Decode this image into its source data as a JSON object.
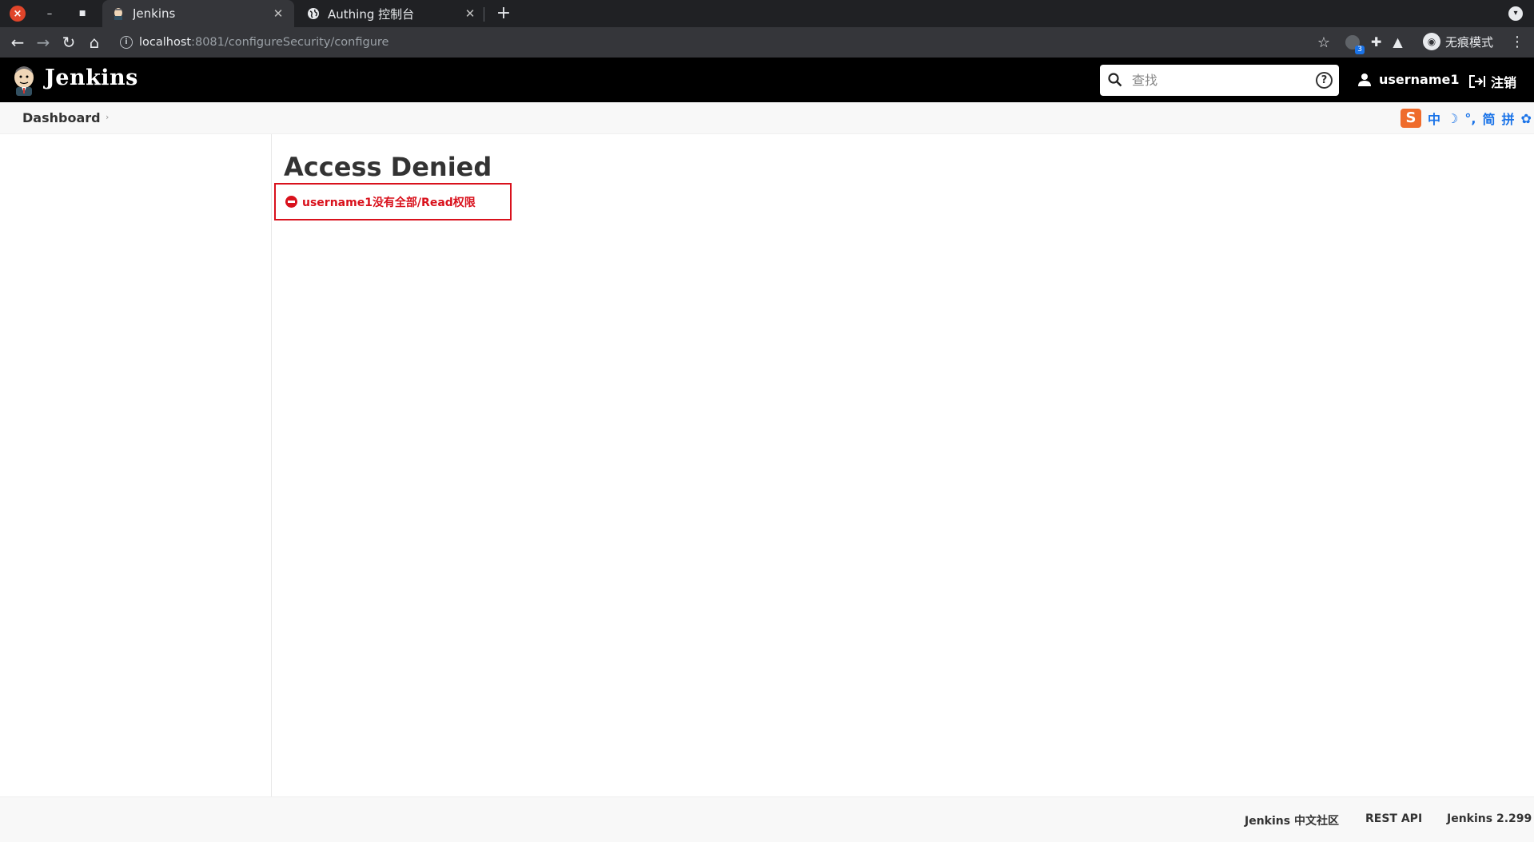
{
  "browser": {
    "tabs": [
      {
        "title": "Jenkins",
        "active": true,
        "icon": "jenkins-favicon"
      },
      {
        "title": "Authing 控制台",
        "active": false,
        "icon": "globe-icon"
      }
    ],
    "url": {
      "host": "localhost",
      "rest": ":8081/configureSecurity/configure"
    },
    "extension_badge": "3",
    "incognito_label": "无痕模式"
  },
  "header": {
    "title": "Jenkins",
    "search": {
      "placeholder": "查找",
      "value": ""
    },
    "username": "username1",
    "logout_label": "注销"
  },
  "breadcrumb": {
    "items": [
      "Dashboard"
    ]
  },
  "ime": {
    "logo": "S",
    "items": [
      "中",
      "☽",
      "°,",
      "简",
      "拼",
      "✿"
    ],
    "color": "#1a73e8"
  },
  "main": {
    "title": "Access Denied",
    "error_message": "username1没有全部/Read权限",
    "error_color": "#d9111c"
  },
  "footer": {
    "links": [
      "Jenkins 中文社区",
      "REST API",
      "Jenkins 2.299"
    ]
  }
}
